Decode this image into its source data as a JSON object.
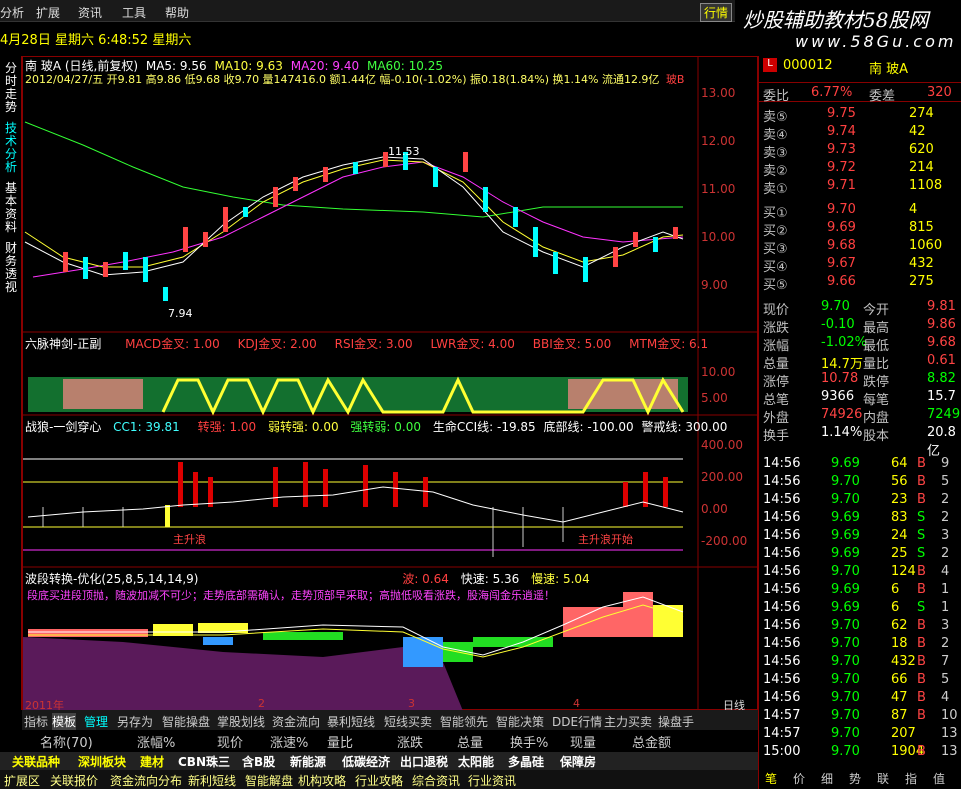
{
  "menu": {
    "items": [
      "分析",
      "扩展",
      "资讯",
      "工具",
      "帮助"
    ],
    "market_btn": "行情"
  },
  "status": {
    "datetime": "4月28日 星期六 6:48:52 星期六"
  },
  "brand": {
    "logo": "炒股辅助教材58股网",
    "url": "www.58Gu.com"
  },
  "sidebar": {
    "tabs": [
      "分时走势",
      "技术分析",
      "基本资料",
      "财务透视"
    ]
  },
  "main": {
    "title": "南 玻A (日线,前复权)",
    "ma": {
      "ma5": "MA5: 9.56",
      "ma10": "MA10: 9.63",
      "ma20": "MA20: 9.40",
      "ma60": "MA60: 10.25"
    },
    "info": "2012/04/27/五 开9.81 高9.86 低9.68 收9.70 量147416.0 额1.44亿 幅-0.10(-1.02%) 振0.18(1.84%) 换1.14% 流通12.9亿",
    "info_tag": "玻B",
    "high_label": "11.53",
    "low_label": "7.94",
    "axis": [
      "13.00",
      "12.00",
      "11.00",
      "10.00",
      "9.00"
    ],
    "p2": {
      "title": "六脉神剑-正副",
      "items": [
        "MACD金叉: 1.00",
        "KDJ金叉: 2.00",
        "RSI金叉: 3.00",
        "LWR金叉: 4.00",
        "BBI金叉: 5.00",
        "MTM金叉: 6.1"
      ],
      "axis": [
        "10.00",
        "5.00"
      ]
    },
    "p3": {
      "title": "战狼-一剑穿心",
      "items": [
        "CC1: 39.81",
        "转强: 1.00",
        "弱转强: 0.00",
        "强转弱: 0.00",
        "生命CCI线: -19.85",
        "底部线: -100.00",
        "警戒线: 300.00"
      ],
      "axis": [
        "400.00",
        "200.00",
        "0.00",
        "-200.00"
      ],
      "marks": [
        "主升浪",
        "主升浪开始"
      ]
    },
    "p4": {
      "title": "波段转换-优化(25,8,5,14,14,9)",
      "items": [
        "波: 0.64",
        "快速: 5.36",
        "慢速: 5.04"
      ],
      "note": "段底买进段顶抛，随波加减不可少；走势底部需确认，走势顶部早采取；高抛低吸看涨跌，股海闯金乐逍遥！"
    },
    "xaxis": [
      "2011年",
      "2",
      "3",
      "4"
    ],
    "period": "日线"
  },
  "bottom_tabs": [
    "指标",
    "模板",
    "管理",
    "另存为",
    "智能操盘",
    "掌股划线",
    "资金流向",
    "暴利短线",
    "短线买卖",
    "智能领先",
    "智能决策",
    "DDE行情",
    "主力买卖",
    "操盘手"
  ],
  "columns": [
    "名称(70)",
    "涨幅%",
    "现价",
    "涨速%",
    "量比",
    "涨跌",
    "总量",
    "换手%",
    "现量",
    "总金额"
  ],
  "blocks": [
    "关联品种",
    "深圳板块",
    "建材",
    "CBN珠三",
    "含B股",
    "新能源",
    "低碳经济",
    "出口退税",
    "太阳能",
    "多晶硅",
    "保障房"
  ],
  "bottom_links": [
    "扩展区",
    "关联报价",
    "资金流向分布",
    "新利短线",
    "智能解盘",
    "机构攻略",
    "行业攻略",
    "综合资讯",
    "行业资讯"
  ],
  "quote": {
    "code": "000012",
    "name": "南 玻A",
    "weibi": {
      "label": "委比",
      "value": "6.77%",
      "label2": "委差",
      "value2": "320"
    },
    "sell": [
      {
        "l": "卖⑤",
        "p": "9.75",
        "v": "274"
      },
      {
        "l": "卖④",
        "p": "9.74",
        "v": "42"
      },
      {
        "l": "卖③",
        "p": "9.73",
        "v": "620"
      },
      {
        "l": "卖②",
        "p": "9.72",
        "v": "214"
      },
      {
        "l": "卖①",
        "p": "9.71",
        "v": "1108"
      }
    ],
    "buy": [
      {
        "l": "买①",
        "p": "9.70",
        "v": "4"
      },
      {
        "l": "买②",
        "p": "9.69",
        "v": "815"
      },
      {
        "l": "买③",
        "p": "9.68",
        "v": "1060"
      },
      {
        "l": "买④",
        "p": "9.67",
        "v": "432"
      },
      {
        "l": "买⑤",
        "p": "9.66",
        "v": "275"
      }
    ],
    "stats": [
      [
        "现价",
        "9.70",
        "今开",
        "9.81"
      ],
      [
        "涨跌",
        "-0.10",
        "最高",
        "9.86"
      ],
      [
        "涨幅",
        "-1.02%",
        "最低",
        "9.68"
      ],
      [
        "总量",
        "14.7万",
        "量比",
        "0.61"
      ],
      [
        "涨停",
        "10.78",
        "跌停",
        "8.82"
      ],
      [
        "总笔",
        "9366",
        "每笔",
        "15.7"
      ],
      [
        "外盘",
        "74926",
        "内盘",
        "72490"
      ],
      [
        "换手",
        "1.14%",
        "股本",
        "20.8亿"
      ]
    ],
    "ticks": [
      [
        "14:56",
        "9.69",
        "64",
        "B",
        "9"
      ],
      [
        "14:56",
        "9.70",
        "56",
        "B",
        "5"
      ],
      [
        "14:56",
        "9.70",
        "23",
        "B",
        "2"
      ],
      [
        "14:56",
        "9.69",
        "83",
        "S",
        "2"
      ],
      [
        "14:56",
        "9.69",
        "24",
        "S",
        "3"
      ],
      [
        "14:56",
        "9.69",
        "25",
        "S",
        "2"
      ],
      [
        "14:56",
        "9.70",
        "124",
        "B",
        "4"
      ],
      [
        "14:56",
        "9.69",
        "6",
        "B",
        "1"
      ],
      [
        "14:56",
        "9.69",
        "6",
        "S",
        "1"
      ],
      [
        "14:56",
        "9.70",
        "62",
        "B",
        "3"
      ],
      [
        "14:56",
        "9.70",
        "18",
        "B",
        "2"
      ],
      [
        "14:56",
        "9.70",
        "432",
        "B",
        "7"
      ],
      [
        "14:56",
        "9.70",
        "66",
        "B",
        "5"
      ],
      [
        "14:56",
        "9.70",
        "47",
        "B",
        "4"
      ],
      [
        "14:57",
        "9.70",
        "87",
        "B",
        "10"
      ],
      [
        "14:57",
        "9.70",
        "207",
        "",
        "13"
      ],
      [
        "15:00",
        "9.70",
        "1904",
        "B",
        "13"
      ]
    ],
    "footer": [
      "笔",
      "价",
      "细",
      "势",
      "联",
      "指",
      "值"
    ]
  }
}
